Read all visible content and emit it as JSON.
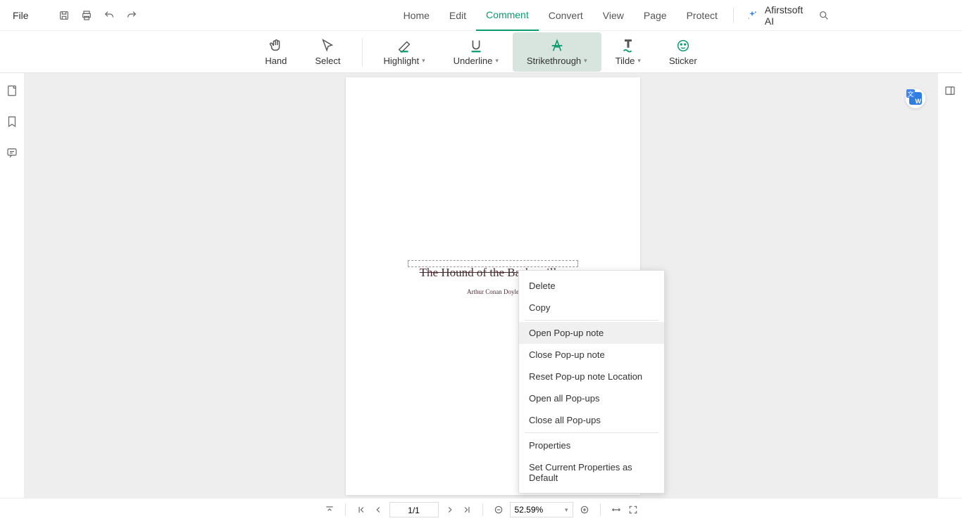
{
  "topbar": {
    "file_label": "File",
    "ai_label": "Afirstsoft AI"
  },
  "tabs": {
    "home": "Home",
    "edit": "Edit",
    "comment": "Comment",
    "convert": "Convert",
    "view": "View",
    "page": "Page",
    "protect": "Protect"
  },
  "ribbon": {
    "hand": "Hand",
    "select": "Select",
    "highlight": "Highlight",
    "underline": "Underline",
    "strikethrough": "Strikethrough",
    "tilde": "Tilde",
    "sticker": "Sticker"
  },
  "document": {
    "title": "The Hound of the Baskervilles",
    "author": "Arthur Conan Doyle"
  },
  "context_menu": {
    "delete": "Delete",
    "copy": "Copy",
    "open_popup": "Open Pop-up note",
    "close_popup": "Close Pop-up note",
    "reset_popup": "Reset Pop-up note Location",
    "open_all": "Open all Pop-ups",
    "close_all": "Close all Pop-ups",
    "properties": "Properties",
    "set_default": "Set Current Properties as Default"
  },
  "status": {
    "page": "1/1",
    "zoom": "52.59%"
  }
}
